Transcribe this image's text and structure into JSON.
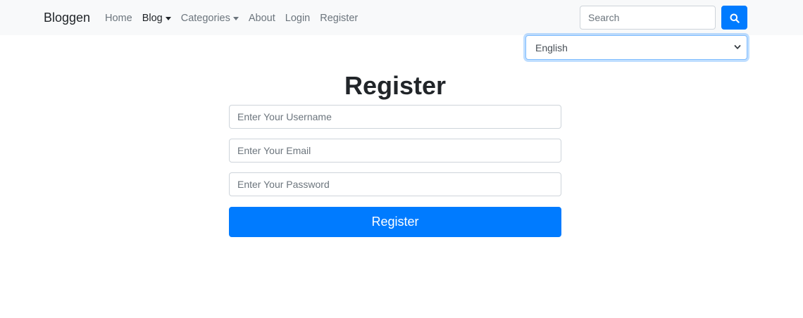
{
  "navbar": {
    "brand": "Bloggen",
    "links": [
      {
        "label": "Home"
      },
      {
        "label": "Blog",
        "dropdown": true,
        "active": true
      },
      {
        "label": "Categories",
        "dropdown": true
      },
      {
        "label": "About"
      },
      {
        "label": "Login"
      },
      {
        "label": "Register"
      }
    ],
    "search": {
      "placeholder": "Search",
      "value": "",
      "icon": "search-icon"
    }
  },
  "language": {
    "selected": "English",
    "icon": "chevron-down-icon"
  },
  "form": {
    "title": "Register",
    "fields": [
      {
        "placeholder": "Enter Your Username"
      },
      {
        "placeholder": "Enter Your Email"
      },
      {
        "placeholder": "Enter Your Password"
      }
    ],
    "submit_label": "Register"
  },
  "colors": {
    "primary": "#007bff",
    "navbar_bg": "#f8f9fa",
    "muted_text": "#6c757d",
    "dark_text": "#212529",
    "border": "#ced4da"
  }
}
